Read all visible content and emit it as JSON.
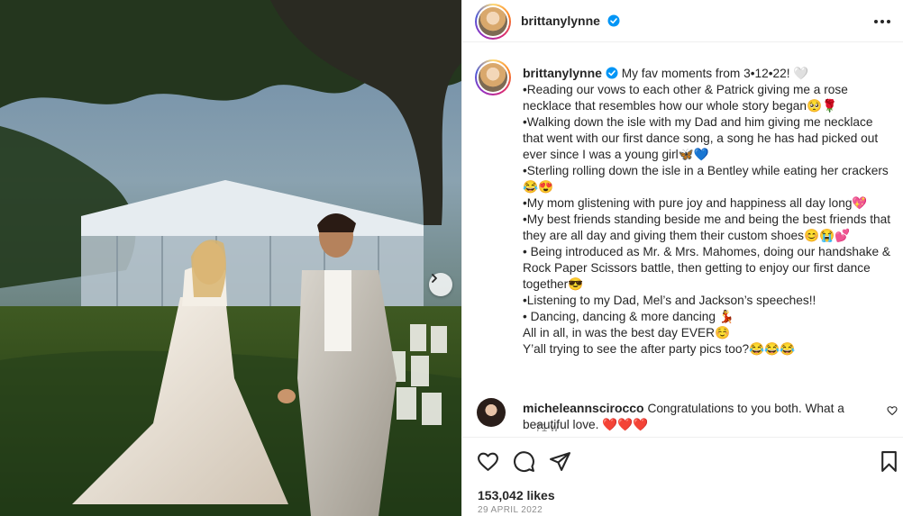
{
  "post": {
    "username": "brittanylynne",
    "verified": true,
    "caption_lines": [
      "My fav moments from 3•12•22! 🤍",
      "•Reading our vows to each other & Patrick giving me a rose necklace that resembles how our whole story began🥺🌹",
      "•Walking down the isle with my Dad and him giving me necklace that went with our first dance song, a song he has had picked out ever since I was a young girl🦋💙",
      "•Sterling rolling down the isle in a Bentley while eating her crackers 😂😍",
      "•My mom glistening with pure joy and happiness all day long💖",
      "•My best friends standing beside me and being the best friends that they are all day and giving them their custom shoes😊😭💕",
      "• Being introduced as Mr. & Mrs. Mahomes, doing our handshake & Rock Paper Scissors battle, then getting to enjoy our first dance together😎",
      "•Listening to my Dad, Mel’s and Jackson’s speeches!!",
      "• Dancing, dancing & more dancing 💃",
      "All in all, in was the best day EVER☺️",
      "Y’all trying to see the after party pics too?😂😂😂"
    ],
    "time_ago": "71 w",
    "likes": "153,042 likes",
    "date": "29 APRIL 2022"
  },
  "comment": {
    "username": "micheleannscirocco",
    "text": "Congratulations to you both. What a beautiful love. ❤️❤️❤️"
  },
  "icons": {
    "verified": "verified-badge-icon",
    "more": "more-options-icon",
    "next": "chevron-right-icon",
    "like": "heart-outline-icon",
    "comment": "comment-bubble-icon",
    "share": "paper-plane-icon",
    "save": "bookmark-icon"
  },
  "colors": {
    "verified_blue": "#0095f6",
    "text": "#262626",
    "muted": "#8e8e8e"
  }
}
